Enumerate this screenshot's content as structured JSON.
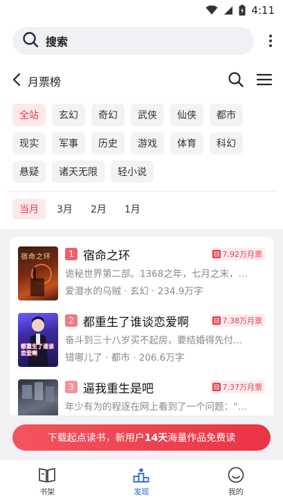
{
  "status": {
    "time": "4:11"
  },
  "search": {
    "placeholder": "搜索"
  },
  "header": {
    "title": "月票榜"
  },
  "categories": [
    "全站",
    "玄幻",
    "奇幻",
    "武侠",
    "仙侠",
    "都市",
    "现实",
    "军事",
    "历史",
    "游戏",
    "体育",
    "科幻",
    "悬疑",
    "诸天无限",
    "轻小说"
  ],
  "periods": [
    "当月",
    "3月",
    "2月",
    "1月"
  ],
  "books": [
    {
      "rank": "1",
      "title": "宿命之环",
      "votes": "7.92万月票",
      "desc": "诡秘世界第二部。1368之年，七月之末，…",
      "meta": "爱潜水的乌贼 · 玄幻 · 234.9万字",
      "cover_text": "宿命之环",
      "rank_color": "#f0606c"
    },
    {
      "rank": "2",
      "title": "都重生了谁谈恋爱啊",
      "votes": "7.38万月票",
      "desc": "奋斗到三十八岁买不起房，要结婚得先付…",
      "meta": "错哪儿了 · 都市 · 206.6万字",
      "cover_text": "都重生了谁谈恋爱啊",
      "rank_color": "#f3787f"
    },
    {
      "rank": "3",
      "title": "逼我重生是吧",
      "votes": "7.37万月票",
      "desc": "年少有为的程逐在网上看到了一个问题：“…",
      "meta": "",
      "cover_text": "",
      "rank_color": "#f59096"
    }
  ],
  "banner": {
    "prefix": "下载起点读书，新用户",
    "highlight": "14天",
    "suffix": "海量作品免费读"
  },
  "tabs": [
    {
      "label": "书架",
      "icon": "book-icon"
    },
    {
      "label": "发现",
      "icon": "podium-icon"
    },
    {
      "label": "我的",
      "icon": "smiley-icon"
    }
  ],
  "colors": {
    "accent": "#ec3a4a",
    "active_tab": "#2a62d8"
  }
}
